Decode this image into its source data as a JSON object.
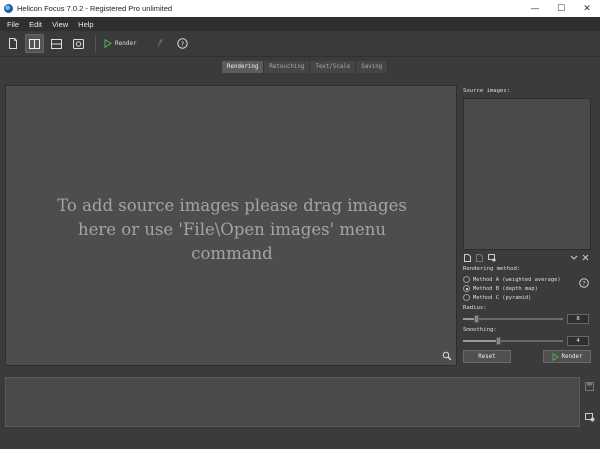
{
  "window": {
    "title": "Helicon Focus 7.0.2 - Registered Pro unlimited",
    "controls": {
      "minimize": "—",
      "maximize": "☐",
      "close": "✕"
    }
  },
  "menu": [
    "File",
    "Edit",
    "View",
    "Help"
  ],
  "toolbar": {
    "render_label": "Render",
    "icons": [
      "new-file-icon",
      "layout-columns-icon",
      "layout-rows-icon",
      "preview-icon",
      "render-play-icon",
      "brush-icon",
      "help-icon"
    ]
  },
  "tabs": [
    {
      "label": "Rendering",
      "active": true
    },
    {
      "label": "Retouching",
      "active": false
    },
    {
      "label": "Text/Scale",
      "active": false
    },
    {
      "label": "Saving",
      "active": false
    }
  ],
  "canvas": {
    "hint": [
      "To add source images please drag images",
      "here or use 'File\\Open images' menu",
      "command"
    ]
  },
  "right_panel": {
    "source_label": "Source images:",
    "rendering_method_label": "Rendering method:",
    "methods": [
      {
        "label": "Method A (weighted average)",
        "checked": false
      },
      {
        "label": "Method B (depth map)",
        "checked": true
      },
      {
        "label": "Method C (pyramid)",
        "checked": false
      }
    ],
    "radius": {
      "label": "Radius:",
      "value": "8",
      "level": 0.12
    },
    "smoothing": {
      "label": "Smoothing:",
      "value": "4",
      "level": 0.35
    },
    "reset_label": "Reset",
    "render_label": "Render"
  },
  "colors": {
    "background": "#3b3b3b",
    "canvas": "#4d4d4d",
    "accent_green": "#4caf50"
  }
}
